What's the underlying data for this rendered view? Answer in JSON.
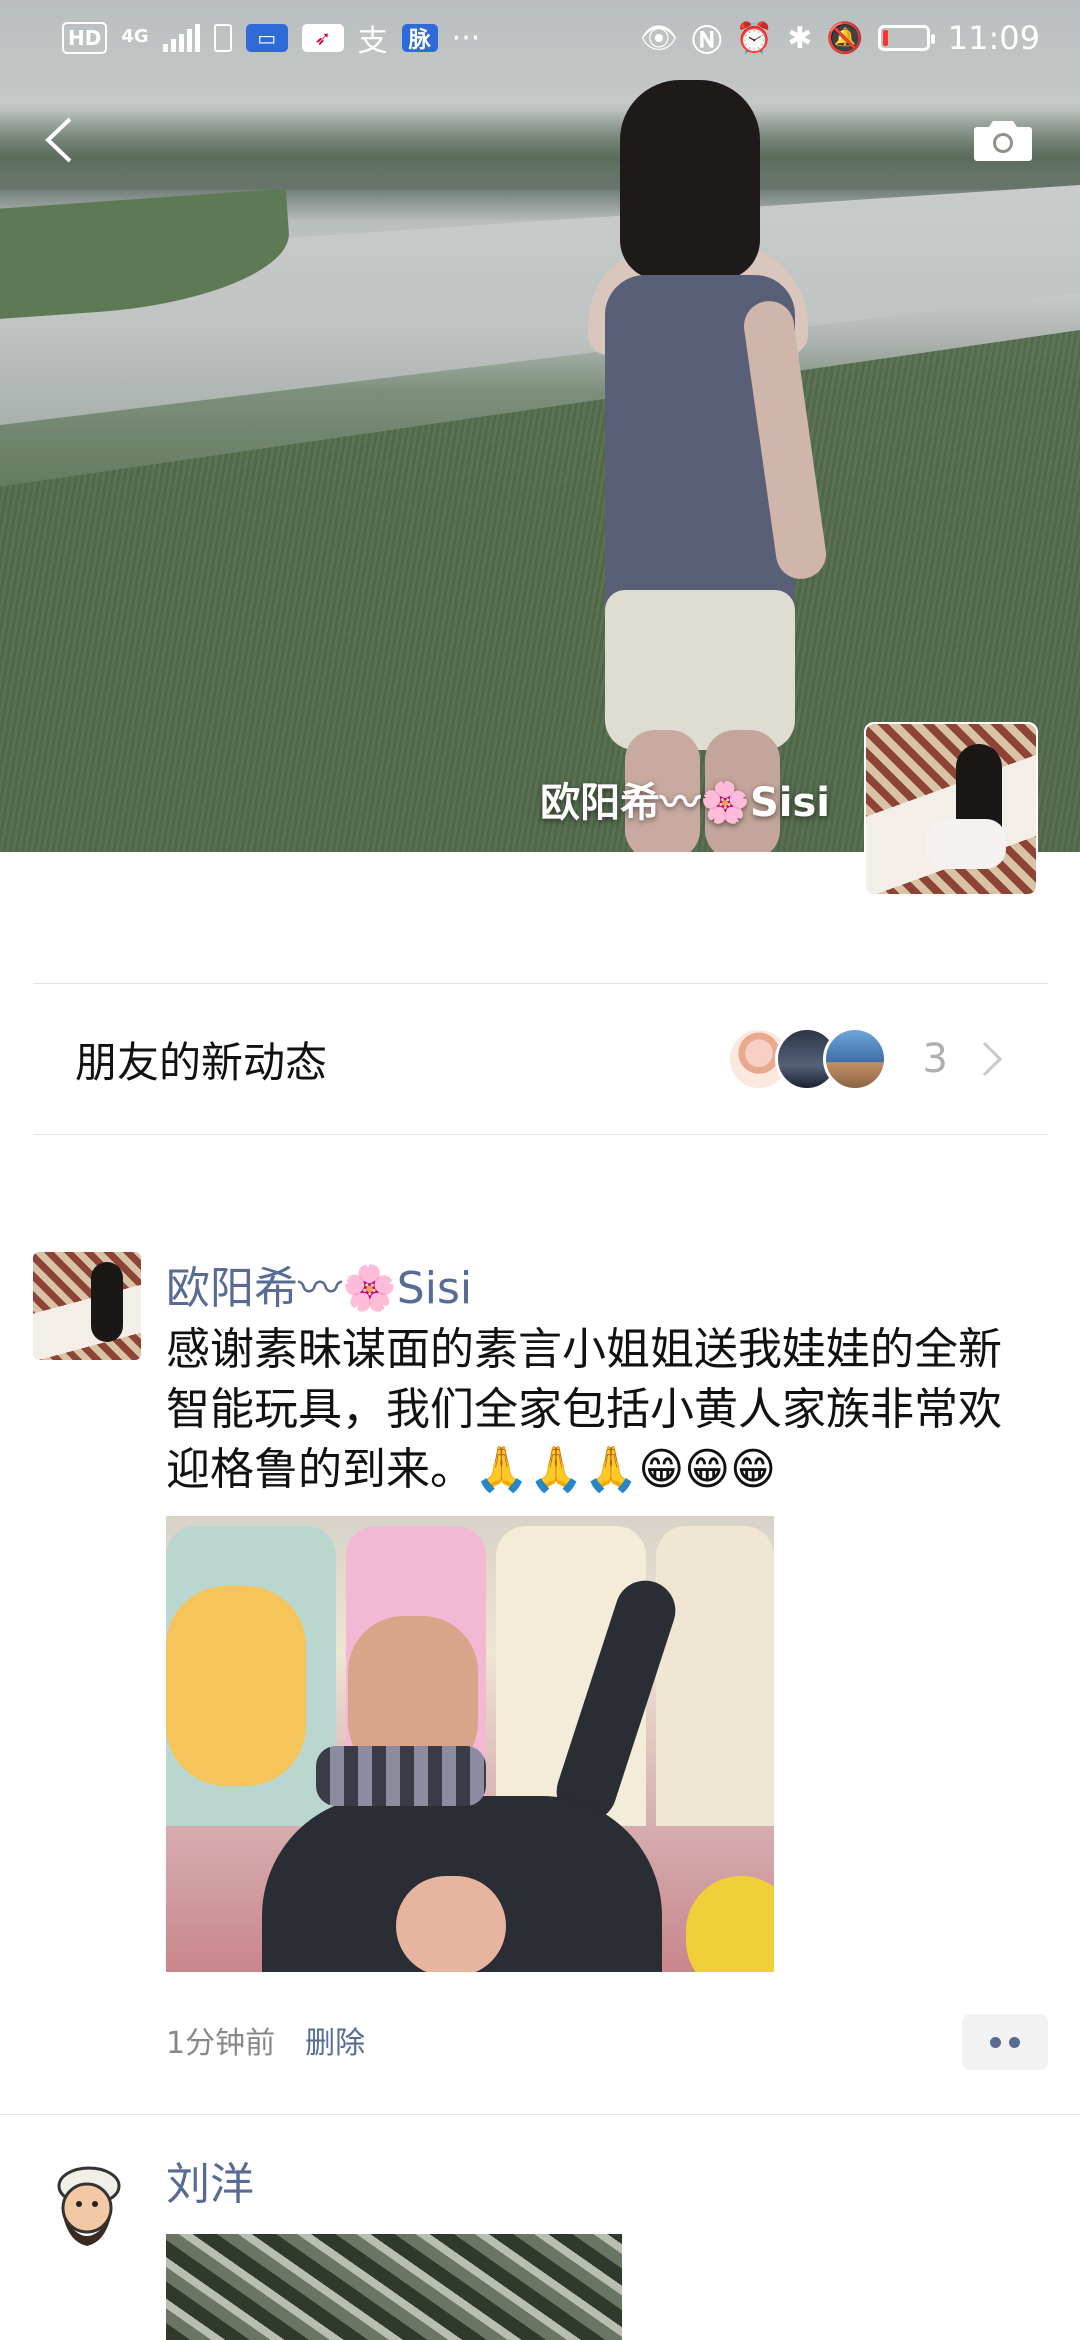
{
  "status_bar": {
    "hd": "HD",
    "network": "4G",
    "app_alipay": "支",
    "app_mai": "脉",
    "more": "···",
    "time": "11:09",
    "battery_level": 0.12
  },
  "cover": {
    "owner_name": "欧阳希〰🌸Sisi"
  },
  "friends_updates": {
    "title": "朋友的新动态",
    "count": "3"
  },
  "post": {
    "author": "欧阳希〰🌸Sisi",
    "text": "感谢素昧谋面的素言小姐姐送我娃娃的全新智能玩具，我们全家包括小黄人家族非常欢迎格鲁的到来。🙏🙏🙏😁😁😁",
    "time": "1分钟前",
    "delete_label": "删除"
  },
  "post2": {
    "author": "刘洋"
  },
  "icons": {
    "back": "chevron-left-icon",
    "camera": "camera-icon",
    "more": "more-dots-icon"
  },
  "colors": {
    "link": "#576b95",
    "meta": "#888888",
    "divider": "#e2e2e2"
  }
}
